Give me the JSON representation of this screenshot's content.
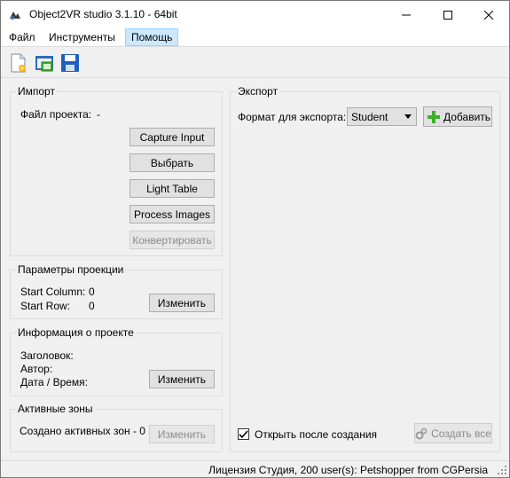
{
  "window": {
    "title": "Object2VR studio 3.1.10 - 64bit"
  },
  "menu": {
    "file": "Файл",
    "tools": "Инструменты",
    "help": "Помощь"
  },
  "toolbar": {
    "icons": [
      "new-project-icon",
      "open-project-icon",
      "save-icon"
    ]
  },
  "import": {
    "title": "Импорт",
    "project_file_label": "Файл проекта:",
    "project_file_value": "-",
    "capture_input": "Capture Input",
    "select": "Выбрать",
    "light_table": "Light Table",
    "process_images": "Process Images",
    "convert": "Конвертировать"
  },
  "projection": {
    "title": "Параметры проекции",
    "start_column_label": "Start Column:",
    "start_column_value": "0",
    "start_row_label": "Start Row:",
    "start_row_value": "0",
    "change": "Изменить"
  },
  "project_info": {
    "title": "Информация о проекте",
    "heading_label": "Заголовок:",
    "author_label": "Автор:",
    "datetime_label": "Дата / Время:",
    "change": "Изменить"
  },
  "hotspots": {
    "title": "Активные зоны",
    "created_label": "Создано активных зон - 0",
    "change": "Изменить"
  },
  "export": {
    "title": "Экспорт",
    "format_label": "Формат для экспорта:",
    "format_value": "Student",
    "add": "Добавить",
    "open_after_label": "Открыть после создания",
    "open_after_checked": true,
    "create_all": "Создать все"
  },
  "status": {
    "text": "Лицензия Студия, 200 user(s): Petshopper from CGPersia"
  },
  "colors": {
    "accent_menu": "#cce8ff",
    "add_icon_green": "#3fae2a",
    "save_icon_blue": "#1f5fbf"
  }
}
